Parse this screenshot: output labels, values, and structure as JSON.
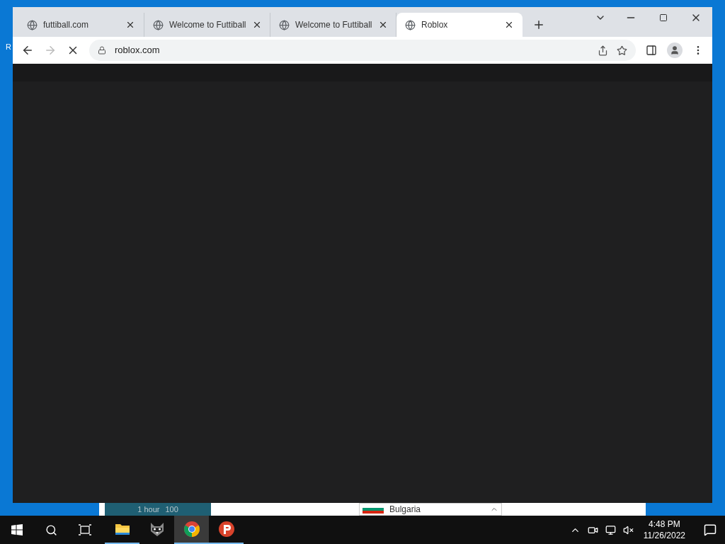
{
  "desktop": {
    "icon_label": "R"
  },
  "background_window": {
    "duration": "1 hour",
    "points": "100",
    "country": "Bulgaria"
  },
  "browser": {
    "tabs": [
      {
        "title": "futtiball.com",
        "selected": false
      },
      {
        "title": "Welcome to Futtiball",
        "selected": false
      },
      {
        "title": "Welcome to Futtiball",
        "selected": false
      },
      {
        "title": "Roblox",
        "selected": true
      }
    ],
    "address": "roblox.com",
    "loading": true
  },
  "taskbar": {
    "apps": [
      {
        "kind": "folder",
        "running": true,
        "selected": false
      },
      {
        "kind": "raccoon",
        "running": false,
        "selected": false
      },
      {
        "kind": "chrome",
        "running": true,
        "selected": true
      },
      {
        "kind": "psiphon",
        "running": true,
        "selected": false
      }
    ],
    "time": "4:48 PM",
    "date": "11/26/2022"
  }
}
